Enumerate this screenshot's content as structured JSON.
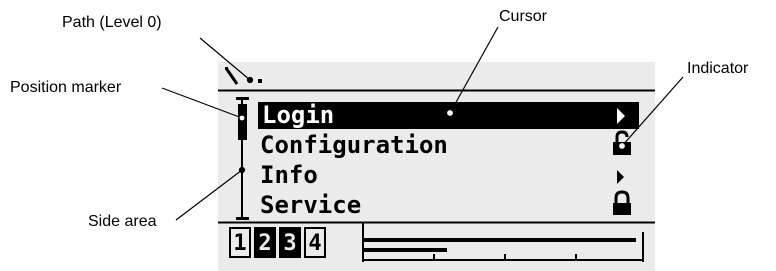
{
  "annotations": {
    "path": "Path (Level 0)",
    "cursor": "Cursor",
    "indicator": "Indicator",
    "position_marker": "Position marker",
    "side_area": "Side area"
  },
  "display": {
    "path_text": "\\",
    "menu": [
      {
        "label": "Login",
        "indicator": "arrow-right",
        "selected": true
      },
      {
        "label": "Configuration",
        "indicator": "lock-open",
        "selected": false
      },
      {
        "label": "Info",
        "indicator": "arrow-right",
        "selected": false
      },
      {
        "label": "Service",
        "indicator": "lock-closed",
        "selected": false
      }
    ],
    "pages": [
      {
        "label": "1",
        "active": false
      },
      {
        "label": "2",
        "active": true
      },
      {
        "label": "3",
        "active": true
      },
      {
        "label": "4",
        "active": false
      }
    ]
  },
  "colors": {
    "screen_background": "#ebebeb",
    "foreground": "#000000",
    "page_background": "#ffffff"
  }
}
